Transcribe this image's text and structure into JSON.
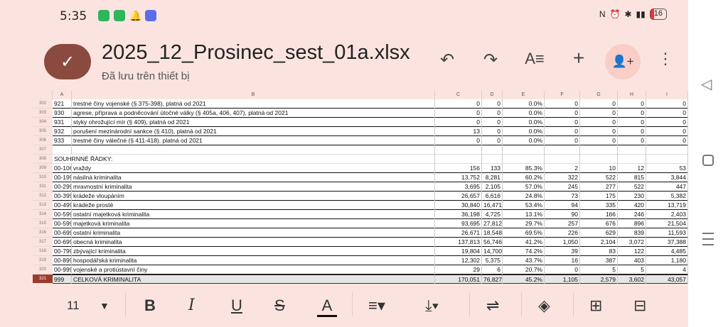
{
  "status": {
    "time": "5:35",
    "battery": "16"
  },
  "file": {
    "title": "2025_12_Prosinec_sest_01a.xlsx",
    "subtitle": "Đã lưu trên thiết bị"
  },
  "columns": [
    "A",
    "B",
    "C",
    "D",
    "E",
    "F",
    "G",
    "H",
    "I"
  ],
  "rows": [
    {
      "num": "302",
      "a": "921",
      "b": "trestné činy vojenské (§ 375-398), platná od 2021",
      "c": "0",
      "d": "0",
      "e": "0.0%",
      "f": "0",
      "g": "0",
      "h": "0",
      "i": "0"
    },
    {
      "num": "303",
      "a": "930",
      "b": "agrese, příprava a podněcování útočné války (§ 405a, 406, 407), platná od 2021",
      "c": "0",
      "d": "0",
      "e": "0.0%",
      "f": "0",
      "g": "0",
      "h": "0",
      "i": "0"
    },
    {
      "num": "304",
      "a": "931",
      "b": "styky ohrožující mír (§ 409), platná od 2021",
      "c": "0",
      "d": "0",
      "e": "0.0%",
      "f": "0",
      "g": "0",
      "h": "0",
      "i": "0"
    },
    {
      "num": "305",
      "a": "932",
      "b": "porušení mezinárodní sankce (§ 410), platná od 2021",
      "c": "13",
      "d": "0",
      "e": "0.0%",
      "f": "0",
      "g": "0",
      "h": "0",
      "i": "0"
    },
    {
      "num": "306",
      "a": "933",
      "b": "trestné činy válečné (§ 411-418), platná od 2021",
      "c": "0",
      "d": "0",
      "e": "0.0%",
      "f": "0",
      "g": "0",
      "h": "0",
      "i": "0"
    },
    {
      "num": "307",
      "a": "",
      "b": "",
      "c": "",
      "d": "",
      "e": "",
      "f": "",
      "g": "",
      "h": "",
      "i": ""
    },
    {
      "num": "308",
      "a": "SOUHRNNÉ ŘÁDKY:",
      "b": "",
      "c": "",
      "d": "",
      "e": "",
      "f": "",
      "g": "",
      "h": "",
      "i": ""
    },
    {
      "num": "309",
      "a": "00-106",
      "b": "vraždy",
      "c": "156",
      "d": "133",
      "e": "85.3%",
      "f": "2",
      "g": "10",
      "h": "12",
      "i": "53"
    },
    {
      "num": "310",
      "a": "00-199",
      "b": "násilná kriminalita",
      "c": "13,752",
      "d": "8,281",
      "e": "60.2%",
      "f": "322",
      "g": "522",
      "h": "815",
      "i": "3,844"
    },
    {
      "num": "311",
      "a": "00-299",
      "b": "mravnostní kriminalita",
      "c": "3,695",
      "d": "2,105",
      "e": "57.0%",
      "f": "245",
      "g": "277",
      "h": "522",
      "i": "447"
    },
    {
      "num": "312",
      "a": "00-399",
      "b": "krádeže vloupáním",
      "c": "26,657",
      "d": "6,616",
      "e": "24.8%",
      "f": "73",
      "g": "175",
      "h": "230",
      "i": "5,382"
    },
    {
      "num": "313",
      "a": "00-499",
      "b": "krádeže prosté",
      "c": "30,840",
      "d": "16,471",
      "e": "53.4%",
      "f": "94",
      "g": "335",
      "h": "420",
      "i": "13,719"
    },
    {
      "num": "314",
      "a": "00-599",
      "b": "ostatní majetková kriminalita",
      "c": "36,198",
      "d": "4,725",
      "e": "13.1%",
      "f": "90",
      "g": "166",
      "h": "246",
      "i": "2,403"
    },
    {
      "num": "315",
      "a": "00-599",
      "b": "majetková kriminalita",
      "c": "93,695",
      "d": "27,812",
      "e": "29.7%",
      "f": "257",
      "g": "676",
      "h": "896",
      "i": "21,504"
    },
    {
      "num": "316",
      "a": "00-699",
      "b": "ostatní kriminalita",
      "c": "26,671",
      "d": "18,548",
      "e": "69.5%",
      "f": "226",
      "g": "629",
      "h": "839",
      "i": "11,593"
    },
    {
      "num": "317",
      "a": "00-699",
      "b": "obecná kriminalita",
      "c": "137,813",
      "d": "56,746",
      "e": "41.2%",
      "f": "1,050",
      "g": "2,104",
      "h": "3,072",
      "i": "37,388"
    },
    {
      "num": "318",
      "a": "00-799",
      "b": "zbývající kriminalita",
      "c": "19,804",
      "d": "14,700",
      "e": "74.2%",
      "f": "39",
      "g": "83",
      "h": "122",
      "i": "4,485"
    },
    {
      "num": "319",
      "a": "00-899",
      "b": "hospodářská kriminalita",
      "c": "12,302",
      "d": "5,375",
      "e": "43.7%",
      "f": "16",
      "g": "387",
      "h": "403",
      "i": "1,180"
    },
    {
      "num": "320",
      "a": "00-999",
      "b": "vojenské a protiústavní činy",
      "c": "29",
      "d": "6",
      "e": "20.7%",
      "f": "0",
      "g": "5",
      "h": "5",
      "i": "4"
    },
    {
      "num": "321",
      "a": "999",
      "b": "CELKOVÁ KRIMINALITA",
      "c": "170,051",
      "d": "76,827",
      "e": "45.2%",
      "f": "1,105",
      "g": "2,579",
      "h": "3,602",
      "i": "43,057"
    }
  ],
  "format": {
    "font_size": "11"
  },
  "icons": [
    "undo-icon",
    "redo-icon",
    "text-format-icon",
    "add-icon",
    "share-person-icon",
    "more-icon",
    "bold-icon",
    "italic-icon",
    "underline-icon",
    "strikethrough-icon",
    "text-color-icon",
    "align-icon",
    "valign-icon",
    "wrap-icon",
    "fill-icon",
    "insert-row-icon",
    "insert-col-icon"
  ]
}
